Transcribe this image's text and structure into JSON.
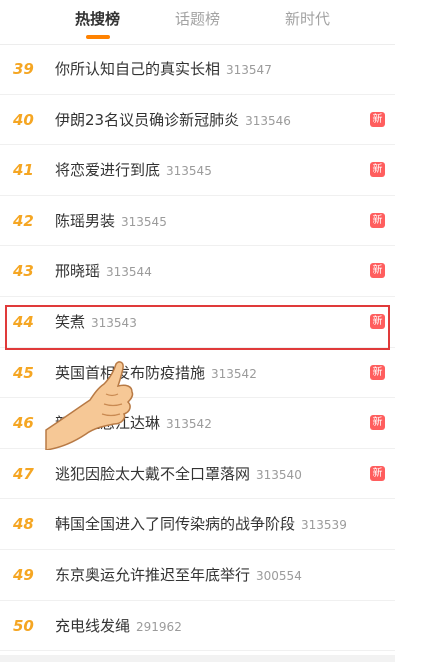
{
  "tabs": [
    {
      "label": "热搜榜",
      "active": true
    },
    {
      "label": "话题榜",
      "active": false
    },
    {
      "label": "新时代",
      "active": false
    }
  ],
  "colors": {
    "accent": "#ff8200",
    "rank": "#f5a623",
    "new_badge": "#ff5e5e",
    "highlight_border": "#e03a3a"
  },
  "highlighted_rank": "44",
  "items": [
    {
      "rank": "39",
      "title": "你所认知自己的真实长相",
      "count": "313547",
      "badge": ""
    },
    {
      "rank": "40",
      "title": "伊朗23名议员确诊新冠肺炎",
      "count": "313546",
      "badge": "新"
    },
    {
      "rank": "41",
      "title": "将恋爱进行到底",
      "count": "313545",
      "badge": "新"
    },
    {
      "rank": "42",
      "title": "陈瑶男装",
      "count": "313545",
      "badge": "新"
    },
    {
      "rank": "43",
      "title": "邢晓瑶",
      "count": "313544",
      "badge": "新"
    },
    {
      "rank": "44",
      "title": "笑煮",
      "count": "313543",
      "badge": "新"
    },
    {
      "rank": "45",
      "title": "英国首相发布防疫措施",
      "count": "313542",
      "badge": "新"
    },
    {
      "rank": "46",
      "title": "新黛拉怼江达琳",
      "count": "313542",
      "badge": "新"
    },
    {
      "rank": "47",
      "title": "逃犯因脸太大戴不全口罩落网",
      "count": "313540",
      "badge": "新"
    },
    {
      "rank": "48",
      "title": "韩国全国进入了同传染病的战争阶段",
      "count": "313539",
      "badge": ""
    },
    {
      "rank": "49",
      "title": "东京奥运允许推迟至年底举行",
      "count": "300554",
      "badge": ""
    },
    {
      "rank": "50",
      "title": "充电线发绳",
      "count": "291962",
      "badge": ""
    }
  ]
}
